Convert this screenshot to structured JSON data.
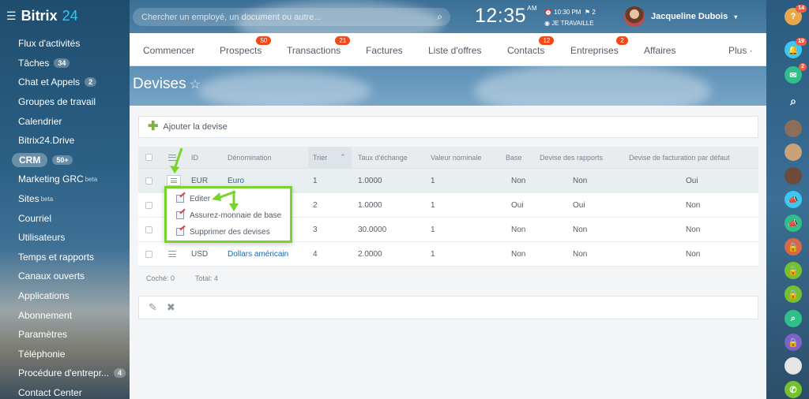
{
  "app": {
    "brand": "Bitrix",
    "brand_num": "24"
  },
  "sidebar": {
    "items": [
      {
        "label": "Flux d'activités"
      },
      {
        "label": "Tâches",
        "count": "34"
      },
      {
        "label": "Chat et Appels",
        "count": "2"
      },
      {
        "label": "Groupes de travail"
      },
      {
        "label": "Calendrier"
      },
      {
        "label": "Bitrix24.Drive"
      },
      {
        "label": "CRM",
        "count": "50+",
        "active": true
      },
      {
        "label": "Marketing GRC",
        "sup": "beta"
      },
      {
        "label": "Sites",
        "sup": "beta"
      },
      {
        "label": "Courriel"
      },
      {
        "label": "Utilisateurs"
      },
      {
        "label": "Temps et rapports"
      },
      {
        "label": "Canaux ouverts"
      },
      {
        "label": "Applications"
      },
      {
        "label": "Abonnement"
      },
      {
        "label": "Paramètres"
      },
      {
        "label": "Téléphonie"
      },
      {
        "label": "Procédure d'entrepr...",
        "count": "4"
      },
      {
        "label": "Contact Center"
      }
    ]
  },
  "header": {
    "search_placeholder": "Chercher un employé, un document ou autre...",
    "time": "12:35",
    "ampm": "AM",
    "alarm": "10:30 PM",
    "flags": "2",
    "work_status": "JE TRAVAILLE",
    "user_name": "Jacqueline Dubois"
  },
  "rightbar": {
    "help_badge": "14",
    "notif_badge": "19",
    "chat_badge": "2"
  },
  "tabs": [
    {
      "label": "Commencer"
    },
    {
      "label": "Prospects",
      "badge": "50"
    },
    {
      "label": "Transactions",
      "badge": "21"
    },
    {
      "label": "Factures"
    },
    {
      "label": "Liste d'offres"
    },
    {
      "label": "Contacts",
      "badge": "12"
    },
    {
      "label": "Entreprises",
      "badge": "2"
    },
    {
      "label": "Affaires"
    },
    {
      "label": "Plus ·"
    }
  ],
  "page": {
    "title": "Devises",
    "add_label": "Ajouter la devise"
  },
  "grid": {
    "headers": {
      "id": "ID",
      "name": "Dénomination",
      "sort": "Trier",
      "rate": "Taux d'échange",
      "nominal": "Valeur nominale",
      "base": "Base",
      "report": "Devise des rapports",
      "invoice": "Devise de facturation par défaut"
    },
    "rows": [
      {
        "id": "EUR",
        "name": "Euro",
        "sort": "1",
        "rate": "1.0000",
        "nominal": "1",
        "base": "Non",
        "report": "Non",
        "invoice": "Oui"
      },
      {
        "id": "",
        "name": "",
        "sort": "2",
        "rate": "1.0000",
        "nominal": "1",
        "base": "Oui",
        "report": "Oui",
        "invoice": "Non"
      },
      {
        "id": "",
        "name": "",
        "sort": "3",
        "rate": "30.0000",
        "nominal": "1",
        "base": "Non",
        "report": "Non",
        "invoice": "Non"
      },
      {
        "id": "USD",
        "name": "Dollars américain",
        "sort": "4",
        "rate": "2.0000",
        "nominal": "1",
        "base": "Non",
        "report": "Non",
        "invoice": "Non"
      }
    ],
    "footer": {
      "checked": "Coché: 0",
      "total": "Total: 4"
    }
  },
  "context_menu": {
    "items": [
      "Editer",
      "Assurez-monnaie de base",
      "Supprimer des devises"
    ]
  },
  "colors": {
    "accent": "#77d428",
    "link": "#2067b0",
    "badge": "#f54819"
  }
}
